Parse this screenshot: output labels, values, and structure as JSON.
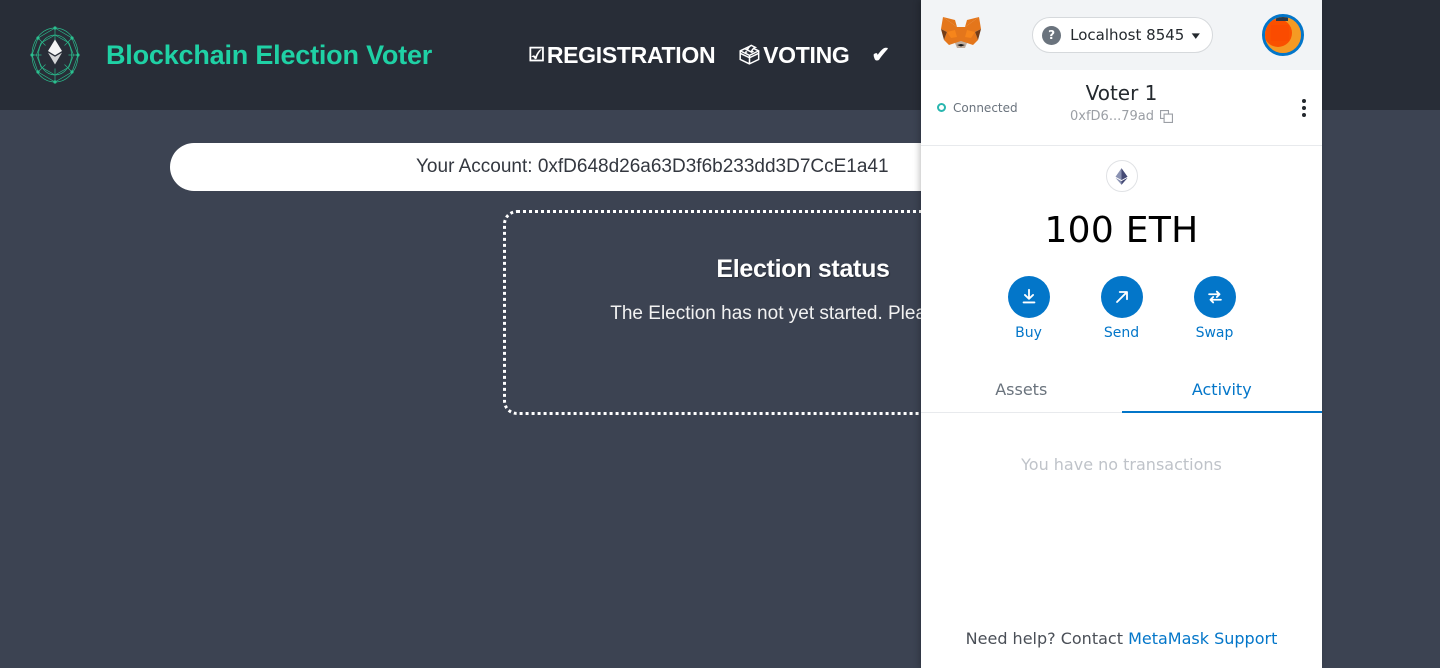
{
  "dapp": {
    "brand": {
      "logo_icon": "ethereum-network-logo",
      "title": "Blockchain Election Voter"
    },
    "nav": [
      {
        "icon": "ballot-check-icon",
        "glyph": "☑",
        "label": "REGISTRATION"
      },
      {
        "icon": "ballot-box-icon",
        "glyph": "🗳",
        "label": "VOTING"
      },
      {
        "icon": "check-mark-icon",
        "glyph": "✔",
        "label": ""
      }
    ],
    "account_bar": {
      "text": "Your Account: 0xfD648d26a63D3f6b233dd3D7CcE1a41"
    },
    "status_panel": {
      "title": "Election status",
      "message": "The Election has not yet started. Please wait.."
    },
    "colors": {
      "navbar_bg": "#282d37",
      "page_bg": "#3c4352",
      "brand_accent": "#1fd1a5"
    }
  },
  "metamask": {
    "header": {
      "logo_icon": "metamask-fox-icon",
      "network_help_icon": "question-mark-icon",
      "network_name": "Localhost 8545",
      "chevron_icon": "chevron-down-icon",
      "avatar_icon": "account-avatar"
    },
    "account": {
      "status_label": "Connected",
      "status_dot_color": "#29b6af",
      "name": "Voter 1",
      "address": "0xfD6...79ad",
      "copy_icon": "copy-icon",
      "menu_icon": "kebab-menu-icon"
    },
    "balance": {
      "token_icon": "ethereum-token-icon",
      "amount": "100 ETH"
    },
    "actions": [
      {
        "icon": "buy-download-icon",
        "label": "Buy"
      },
      {
        "icon": "send-arrow-icon",
        "label": "Send"
      },
      {
        "icon": "swap-arrows-icon",
        "label": "Swap"
      }
    ],
    "tabs": [
      {
        "label": "Assets",
        "active": false
      },
      {
        "label": "Activity",
        "active": true
      }
    ],
    "empty_state": "You have no transactions",
    "footer": {
      "prefix": "Need help? Contact ",
      "link": "MetaMask Support"
    },
    "colors": {
      "accent": "#0376c9",
      "header_bg": "#f2f4f6"
    }
  }
}
